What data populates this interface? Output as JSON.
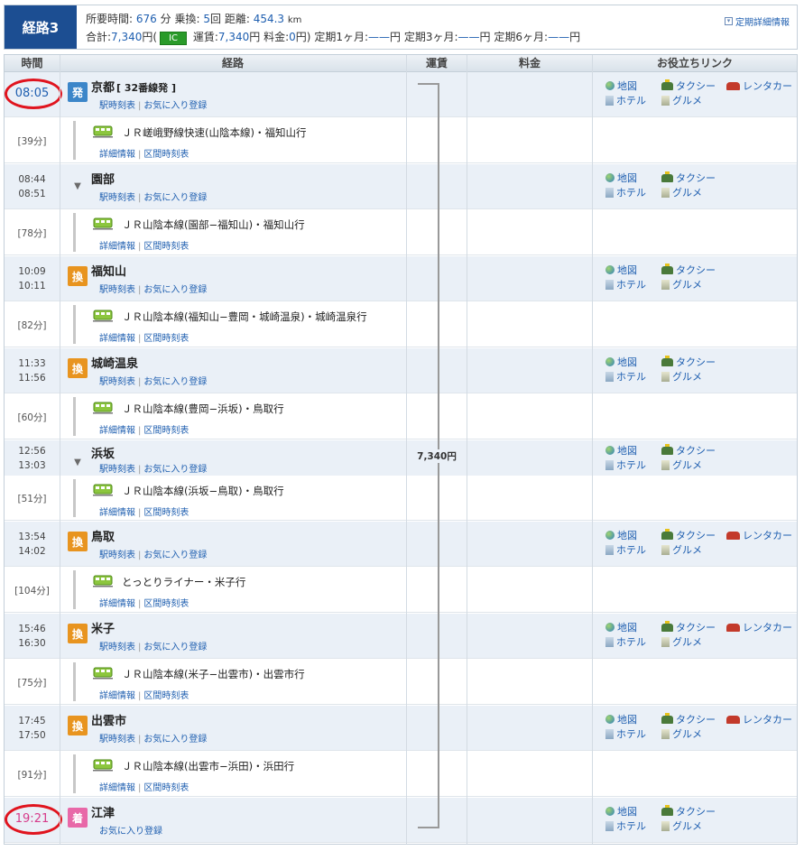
{
  "summary": {
    "route_label": "経路3",
    "time_label": "所要時間:",
    "time_value": "676",
    "time_unit": "分",
    "transfer_label": "乗換:",
    "transfer_value": "5",
    "transfer_unit": "回",
    "distance_label": "距離:",
    "distance_value": "454.3",
    "distance_unit": "km",
    "total_label": "合計:",
    "total_value": "7,340",
    "total_unit": "円(",
    "ic_label": "IC",
    "fare_label": "運賃:",
    "fare_value": "7,340",
    "fare_unit": "円",
    "charge_label": "料金:",
    "charge_value": "0",
    "charge_unit": "円)",
    "teiki1_label": "定期1ヶ月:",
    "teiki1_value": "——",
    "teiki3_label": "定期3ヶ月:",
    "teiki3_value": "——",
    "teiki6_label": "定期6ヶ月:",
    "teiki6_value": "——",
    "yen": "円",
    "teiki_detail_link": "定期詳細情報"
  },
  "columns": {
    "time": "時間",
    "route": "経路",
    "fare": "運賃",
    "charge": "料金",
    "links": "お役立ちリンク"
  },
  "link_labels": {
    "map": "地図",
    "taxi": "タクシー",
    "rental": "レンタカー",
    "hotel": "ホテル",
    "gourmet": "グルメ",
    "timetable": "駅時刻表",
    "favorite": "お気に入り登録",
    "detail": "詳細情報",
    "section_timetable": "区間時刻表",
    "sep": "|"
  },
  "fare_total": "7,340円",
  "stations": [
    {
      "time1": "08:05",
      "time2": "",
      "icon": "発",
      "type": "dep",
      "name": "京都",
      "platform": "[ 32番線発 ]",
      "rental": true
    },
    {
      "time1": "08:44",
      "time2": "08:51",
      "icon": "▼",
      "type": "pass",
      "name": "園部",
      "platform": "",
      "rental": false
    },
    {
      "time1": "10:09",
      "time2": "10:11",
      "icon": "換",
      "type": "chg",
      "name": "福知山",
      "platform": "",
      "rental": false
    },
    {
      "time1": "11:33",
      "time2": "11:56",
      "icon": "換",
      "type": "chg",
      "name": "城崎温泉",
      "platform": "",
      "rental": false
    },
    {
      "time1": "12:56",
      "time2": "13:03",
      "icon": "▼",
      "type": "pass",
      "name": "浜坂",
      "platform": "",
      "rental": false
    },
    {
      "time1": "13:54",
      "time2": "14:02",
      "icon": "換",
      "type": "chg",
      "name": "鳥取",
      "platform": "",
      "rental": true
    },
    {
      "time1": "15:46",
      "time2": "16:30",
      "icon": "換",
      "type": "chg",
      "name": "米子",
      "platform": "",
      "rental": true
    },
    {
      "time1": "17:45",
      "time2": "17:50",
      "icon": "換",
      "type": "chg",
      "name": "出雲市",
      "platform": "",
      "rental": true
    },
    {
      "time1": "19:21",
      "time2": "",
      "icon": "着",
      "type": "arr",
      "name": "江津",
      "platform": "",
      "rental": false
    }
  ],
  "segments": [
    {
      "duration": "[39分]",
      "line": "ＪＲ嵯峨野線快速(山陰本線)・福知山行"
    },
    {
      "duration": "[78分]",
      "line": "ＪＲ山陰本線(園部−福知山)・福知山行"
    },
    {
      "duration": "[82分]",
      "line": "ＪＲ山陰本線(福知山−豊岡・城崎温泉)・城崎温泉行"
    },
    {
      "duration": "[60分]",
      "line": "ＪＲ山陰本線(豊岡−浜坂)・鳥取行"
    },
    {
      "duration": "[51分]",
      "line": "ＪＲ山陰本線(浜坂−鳥取)・鳥取行"
    },
    {
      "duration": "[104分]",
      "line": "とっとりライナー・米子行"
    },
    {
      "duration": "[75分]",
      "line": "ＪＲ山陰本線(米子−出雲市)・出雲市行"
    },
    {
      "duration": "[91分]",
      "line": "ＪＲ山陰本線(出雲市−浜田)・浜田行"
    }
  ],
  "colors": {
    "accent": "#1c4e92",
    "link": "#1f5fb0",
    "dep": "#3c86c9",
    "chg": "#e8941f",
    "arr": "#e868a8",
    "ic": "#2a9b2a",
    "highlight": "#e0141e"
  }
}
